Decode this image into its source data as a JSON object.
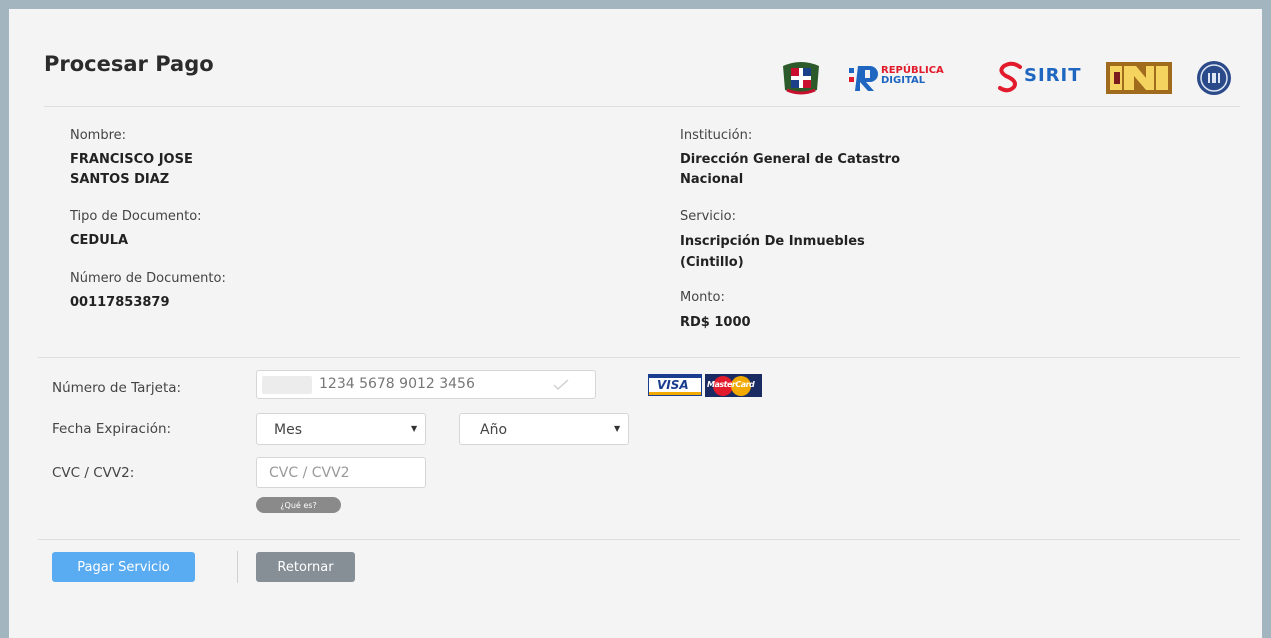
{
  "header": {
    "title": "Procesar Pago",
    "republica_text_1": "REPÚBLICA",
    "republica_text_2": "DIGITAL",
    "sirit_text": "SIRIT"
  },
  "payer": {
    "name_label": "Nombre:",
    "name_line1": "FRANCISCO JOSE",
    "name_line2": "SANTOS DIAZ",
    "doc_type_label": "Tipo de Documento:",
    "doc_type_value": "CEDULA",
    "doc_number_label": "Número de Documento:",
    "doc_number_value": "00117853879"
  },
  "service": {
    "institution_label": "Institución:",
    "institution_line1": "Dirección General de Catastro",
    "institution_line2": "Nacional",
    "service_label": "Servicio:",
    "service_line1": "Inscripción De Inmuebles",
    "service_line2": "(Cintillo)",
    "amount_label": "Monto:",
    "amount_value": "RD$ 1000"
  },
  "form": {
    "card_number_label": "Número de Tarjeta:",
    "card_number_placeholder": "1234 5678 9012 3456",
    "expiration_label": "Fecha Expiración:",
    "month_selected": "Mes",
    "year_selected": "Año",
    "cvc_label": "CVC / CVV2:",
    "cvc_placeholder": "CVC / CVV2",
    "what_is_label": "¿Qué es?",
    "visa_text": "VISA",
    "mastercard_text": "MasterCard"
  },
  "actions": {
    "pay_label": "Pagar Servicio",
    "back_label": "Retornar"
  },
  "colors": {
    "page_background": "#a3b6bf",
    "panel_background": "#f4f4f4",
    "pay_button": "#5aacf2",
    "back_button": "#868e96"
  }
}
